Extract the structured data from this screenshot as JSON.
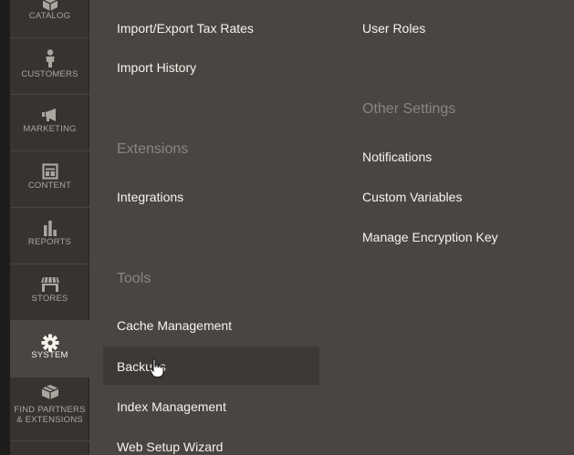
{
  "sidebar": {
    "items": [
      {
        "label": "CATALOG",
        "icon": "cube-icon"
      },
      {
        "label": "CUSTOMERS",
        "icon": "person-icon"
      },
      {
        "label": "MARKETING",
        "icon": "megaphone-icon"
      },
      {
        "label": "CONTENT",
        "icon": "layout-icon"
      },
      {
        "label": "REPORTS",
        "icon": "bar-chart-icon"
      },
      {
        "label": "STORES",
        "icon": "storefront-icon"
      },
      {
        "label": "SYSTEM",
        "icon": "gear-icon",
        "active": true
      },
      {
        "label_line1": "FIND PARTNERS",
        "label_line2": "& EXTENSIONS",
        "icon": "box-icon"
      }
    ]
  },
  "menu": {
    "column1": {
      "items_top": [
        "Import/Export Tax Rates",
        "Import History"
      ],
      "extensions": {
        "title": "Extensions",
        "items": [
          "Integrations"
        ]
      },
      "tools": {
        "title": "Tools",
        "items": [
          "Cache Management",
          "Backups",
          "Index Management",
          "Web Setup Wizard"
        ]
      }
    },
    "column2": {
      "items_top": [
        "User Roles"
      ],
      "other_settings": {
        "title": "Other Settings",
        "items": [
          "Notifications",
          "Custom Variables",
          "Manage Encryption Key"
        ]
      }
    },
    "hovered_item": "Backups"
  },
  "colors": {
    "sidebar_bg": "#373330",
    "panel_bg": "#4a4542",
    "link_text": "#f7f3eb",
    "section_title": "#8a8480",
    "nav_text": "#aaa6a0"
  }
}
